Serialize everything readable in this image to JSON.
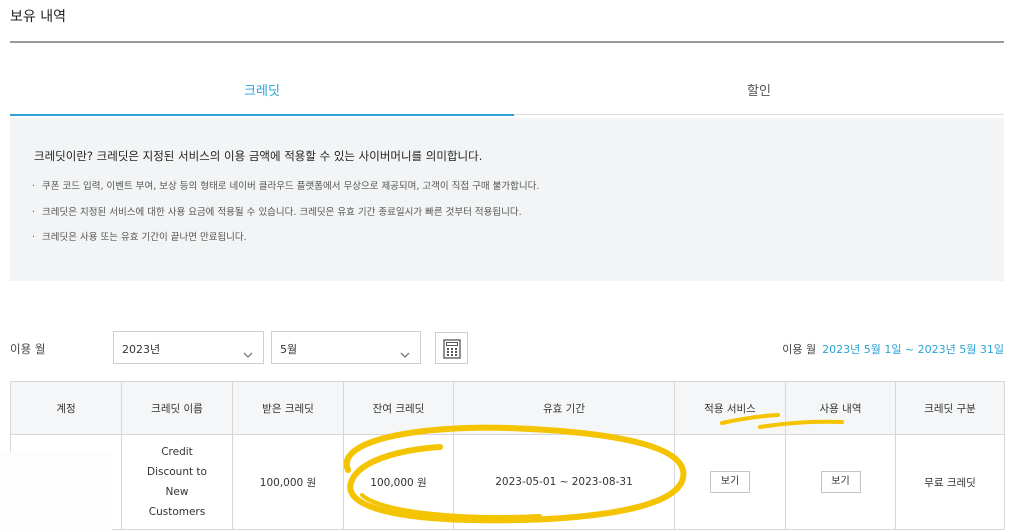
{
  "page": {
    "title": "보유 내역"
  },
  "tabs": [
    {
      "label": "크레딧",
      "active": true
    },
    {
      "label": "할인",
      "active": false
    }
  ],
  "info": {
    "headline": "크레딧이란? 크레딧은 지정된 서비스의 이용 금액에 적용할 수 있는 사이버머니를 의미합니다.",
    "bullets": [
      "쿠폰 코드 입력, 이벤트 부여, 보상 등의 형태로 네이버 클라우드 플랫폼에서 무상으로 제공되며, 고객이 직접 구매 불가합니다.",
      "크레딧은 지정된 서비스에 대한 사용 요금에 적용될 수 있습니다. 크레딧은 유효 기간 종료일시가 빠른 것부터 적용됩니다.",
      "크레딧은 사용 또는 유효 기간이 끝나면 만료됩니다."
    ]
  },
  "filter": {
    "label": "이용 월",
    "year": "2023년",
    "month": "5월",
    "period_label": "이용 월",
    "period_range": "2023년 5월 1일 ~ 2023년 5월 31일"
  },
  "table": {
    "headers": [
      "계정",
      "크레딧 이름",
      "받은 크레딧",
      "잔여 크레딧",
      "유효 기간",
      "적용 서비스",
      "사용 내역",
      "크레딧 구분"
    ],
    "rows": [
      {
        "account": "",
        "name": "Credit Discount to New Customers",
        "received": "100,000 원",
        "remaining": "100,000 원",
        "validity": "2023-05-01 ~ 2023-08-31",
        "service_button": "보기",
        "usage_button": "보기",
        "type": "무료 크레딧"
      }
    ]
  },
  "colors": {
    "accent": "#2aa3d6",
    "highlight": "#f5c400",
    "info_bg": "#f2f4f5"
  },
  "icons": {
    "select_arrow": "chevron-down-icon",
    "calendar": "calendar-icon"
  }
}
